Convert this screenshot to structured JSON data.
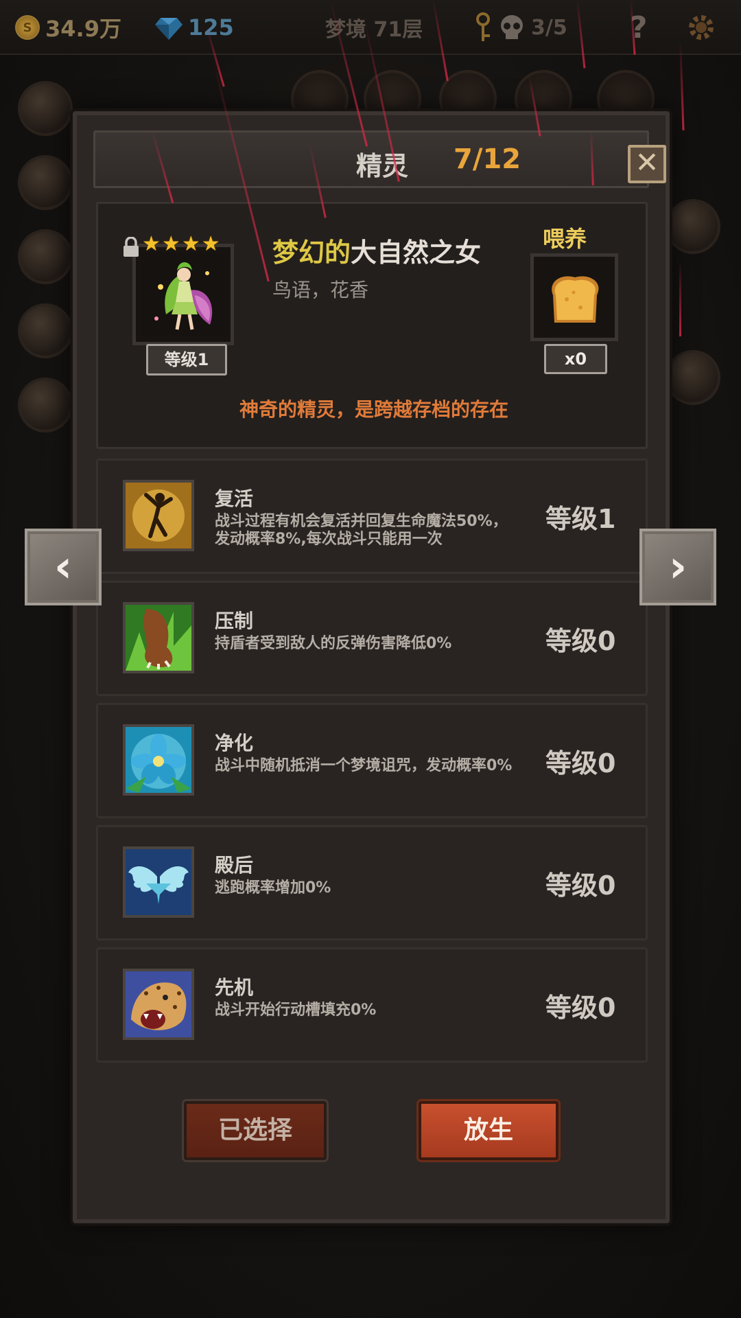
{
  "hud": {
    "gold": "34.9万",
    "gems": "125",
    "floor": "梦境 71层",
    "keys_or_skulls": "3/5",
    "help": "?",
    "coin_glyph": "S"
  },
  "panel": {
    "title": "精灵",
    "count": "7/12",
    "close": "✕"
  },
  "spirit": {
    "stars": 4,
    "name_prefix": "梦幻的",
    "name_main": "大自然之女",
    "subtitle": "鸟语，花香",
    "level": "等级1",
    "feed_label": "喂养",
    "feed_count": "x0",
    "tagline": "神奇的精灵，是跨越存档的存在"
  },
  "skills": [
    {
      "name": "复活",
      "desc": "战斗过程有机会复活并回复生命魔法50%，发动概率8%,每次战斗只能用一次",
      "level": "等级1",
      "icon": "revive-dancer-icon"
    },
    {
      "name": "压制",
      "desc": "持盾者受到敌人的反弹伤害降低0%",
      "level": "等级0",
      "icon": "beast-paw-icon"
    },
    {
      "name": "净化",
      "desc": "战斗中随机抵消一个梦境诅咒，发动概率0%",
      "level": "等级0",
      "icon": "blue-flower-icon"
    },
    {
      "name": "殿后",
      "desc": "逃跑概率增加0%",
      "level": "等级0",
      "icon": "angel-wings-icon"
    },
    {
      "name": "先机",
      "desc": "战斗开始行动槽填充0%",
      "level": "等级0",
      "icon": "leopard-icon"
    }
  ],
  "nav": {
    "prev": "‹",
    "next": "›"
  },
  "buttons": {
    "selected": "已选择",
    "release": "放生"
  },
  "colors": {
    "accent_orange": "#e9a53c",
    "name_yellow": "#dec845",
    "tagline_orange": "#e07b3a",
    "release_red": "#c8502e"
  }
}
